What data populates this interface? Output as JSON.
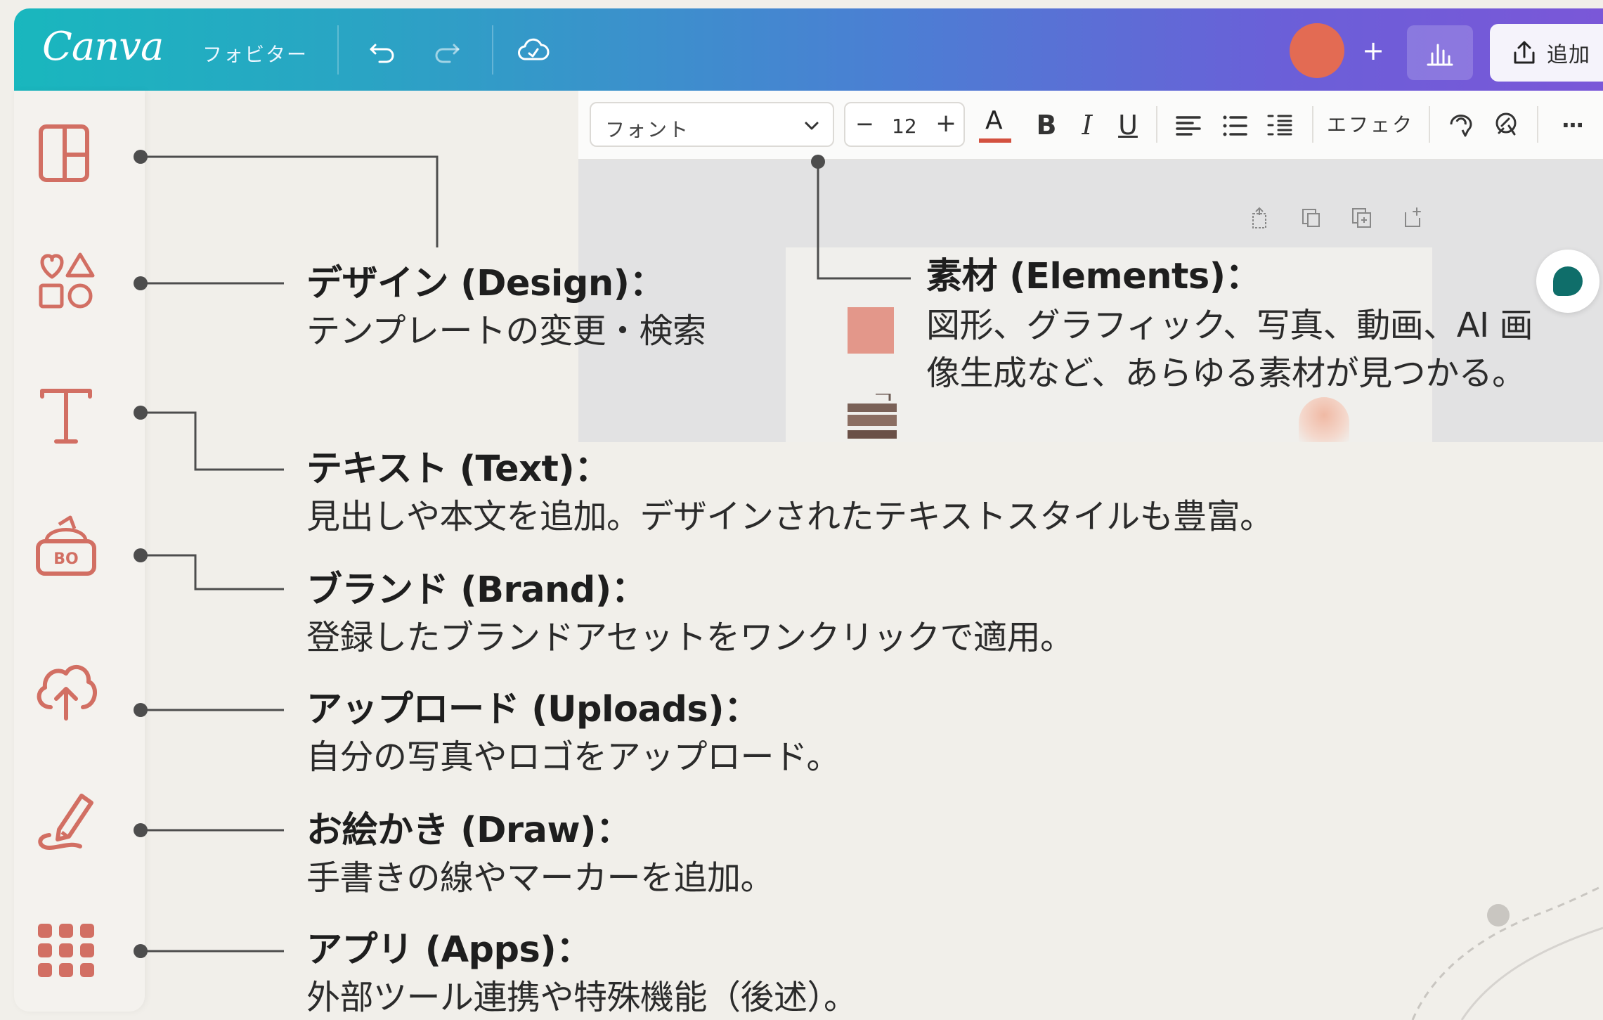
{
  "topbar": {
    "logo": "Canva",
    "file_label": "フォビター",
    "share_label": "追加",
    "colors": {
      "gradient_start": "#19b7be",
      "gradient_end": "#7a57d8",
      "avatar": "#e36b53"
    },
    "icons": [
      "undo-icon",
      "redo-icon",
      "cloud-sync-icon",
      "plus-icon",
      "stats-icon",
      "share-icon"
    ]
  },
  "toolbar": {
    "font_placeholder": "フォント",
    "font_size": "12",
    "font_size_minus": "−",
    "font_size_plus": "+",
    "bold": "B",
    "italic": "I",
    "underline": "U",
    "effects": "エフェク",
    "more": "···"
  },
  "sidebar": {
    "accent_color": "#d26f63",
    "icons": [
      "design-icon",
      "elements-icon",
      "text-icon",
      "brand-icon",
      "uploads-icon",
      "draw-icon",
      "apps-icon"
    ]
  },
  "annotations": {
    "design": {
      "title": "デザイン (Design)：",
      "desc": "テンプレートの変更・検索"
    },
    "elements": {
      "title": "素材 (Elements)：",
      "desc": "図形、グラフィック、写真、動画、AI 画像生成など、あらゆる素材が見つかる。"
    },
    "text": {
      "title": "テキスト (Text)：",
      "desc": "見出しや本文を追加。デザインされたテキストスタイルも豊富。"
    },
    "brand": {
      "title": "ブランド (Brand)：",
      "desc": "登録したブランドアセットをワンクリックで適用。"
    },
    "uploads": {
      "title": "アップロード (Uploads)：",
      "desc": "自分の写真やロゴをアップロード。"
    },
    "draw": {
      "title": "お絵かき (Draw)：",
      "desc": "手書きの線やマーカーを追加。"
    },
    "apps": {
      "title": "アプリ (Apps)：",
      "desc": "外部ツール連携や特殊機能（後述）。"
    }
  },
  "brand_icon_text": "BO"
}
